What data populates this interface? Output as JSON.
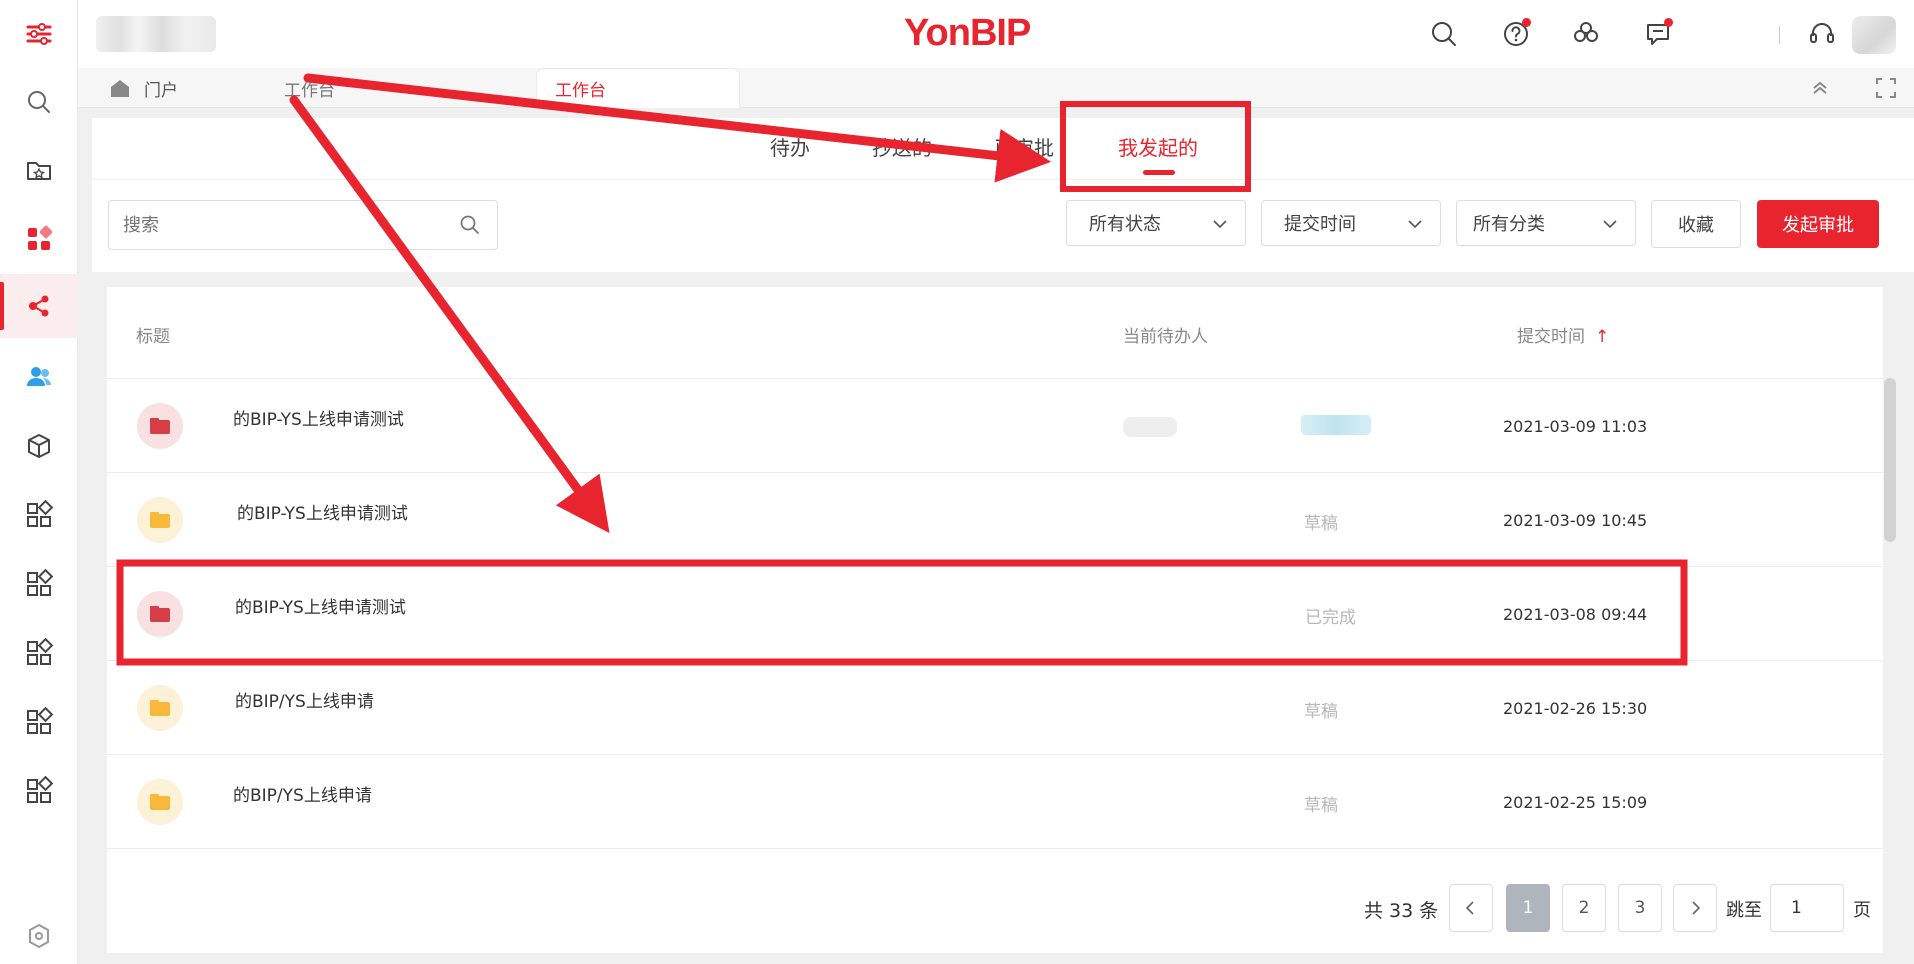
{
  "app": {
    "brand": "YonBIP"
  },
  "window_tabs": [
    {
      "label": "门户"
    },
    {
      "label": "工作台"
    },
    {
      "label": "工作台"
    }
  ],
  "sub_tabs": [
    {
      "label": "待办"
    },
    {
      "label": "抄送的"
    },
    {
      "label": "已审批"
    },
    {
      "label": "我发起的",
      "active": true
    }
  ],
  "search": {
    "placeholder": "搜索"
  },
  "filters": {
    "status": "所有状态",
    "time": "提交时间",
    "category": "所有分类"
  },
  "buttons": {
    "favorite": "收藏",
    "start_approval": "发起审批"
  },
  "table": {
    "columns": {
      "title": "标题",
      "assignee": "当前待办人",
      "submit_time": "提交时间",
      "sort_arrow": "↑"
    },
    "rows": [
      {
        "title": "的BIP-YS上线申请测试",
        "status": "",
        "time": "2021-03-09 11:03",
        "icon_color": "red"
      },
      {
        "title": "的BIP-YS上线申请测试",
        "status": "草稿",
        "time": "2021-03-09 10:45",
        "icon_color": "yellow"
      },
      {
        "title": "的BIP-YS上线申请测试",
        "status": "已完成",
        "time": "2021-03-08 09:44",
        "icon_color": "red"
      },
      {
        "title": "的BIP/YS上线申请",
        "status": "草稿",
        "time": "2021-02-26 15:30",
        "icon_color": "yellow"
      },
      {
        "title": "的BIP/YS上线申请",
        "status": "草稿",
        "time": "2021-02-25 15:09",
        "icon_color": "yellow"
      }
    ]
  },
  "pagination": {
    "total_text": "共 33 条",
    "pages": [
      "1",
      "2",
      "3"
    ],
    "current_page": "1",
    "goto_label": "跳至",
    "goto_value": "1",
    "page_suffix": "页"
  },
  "colors": {
    "accent": "#e8242f",
    "annotation": "#e8242f"
  }
}
